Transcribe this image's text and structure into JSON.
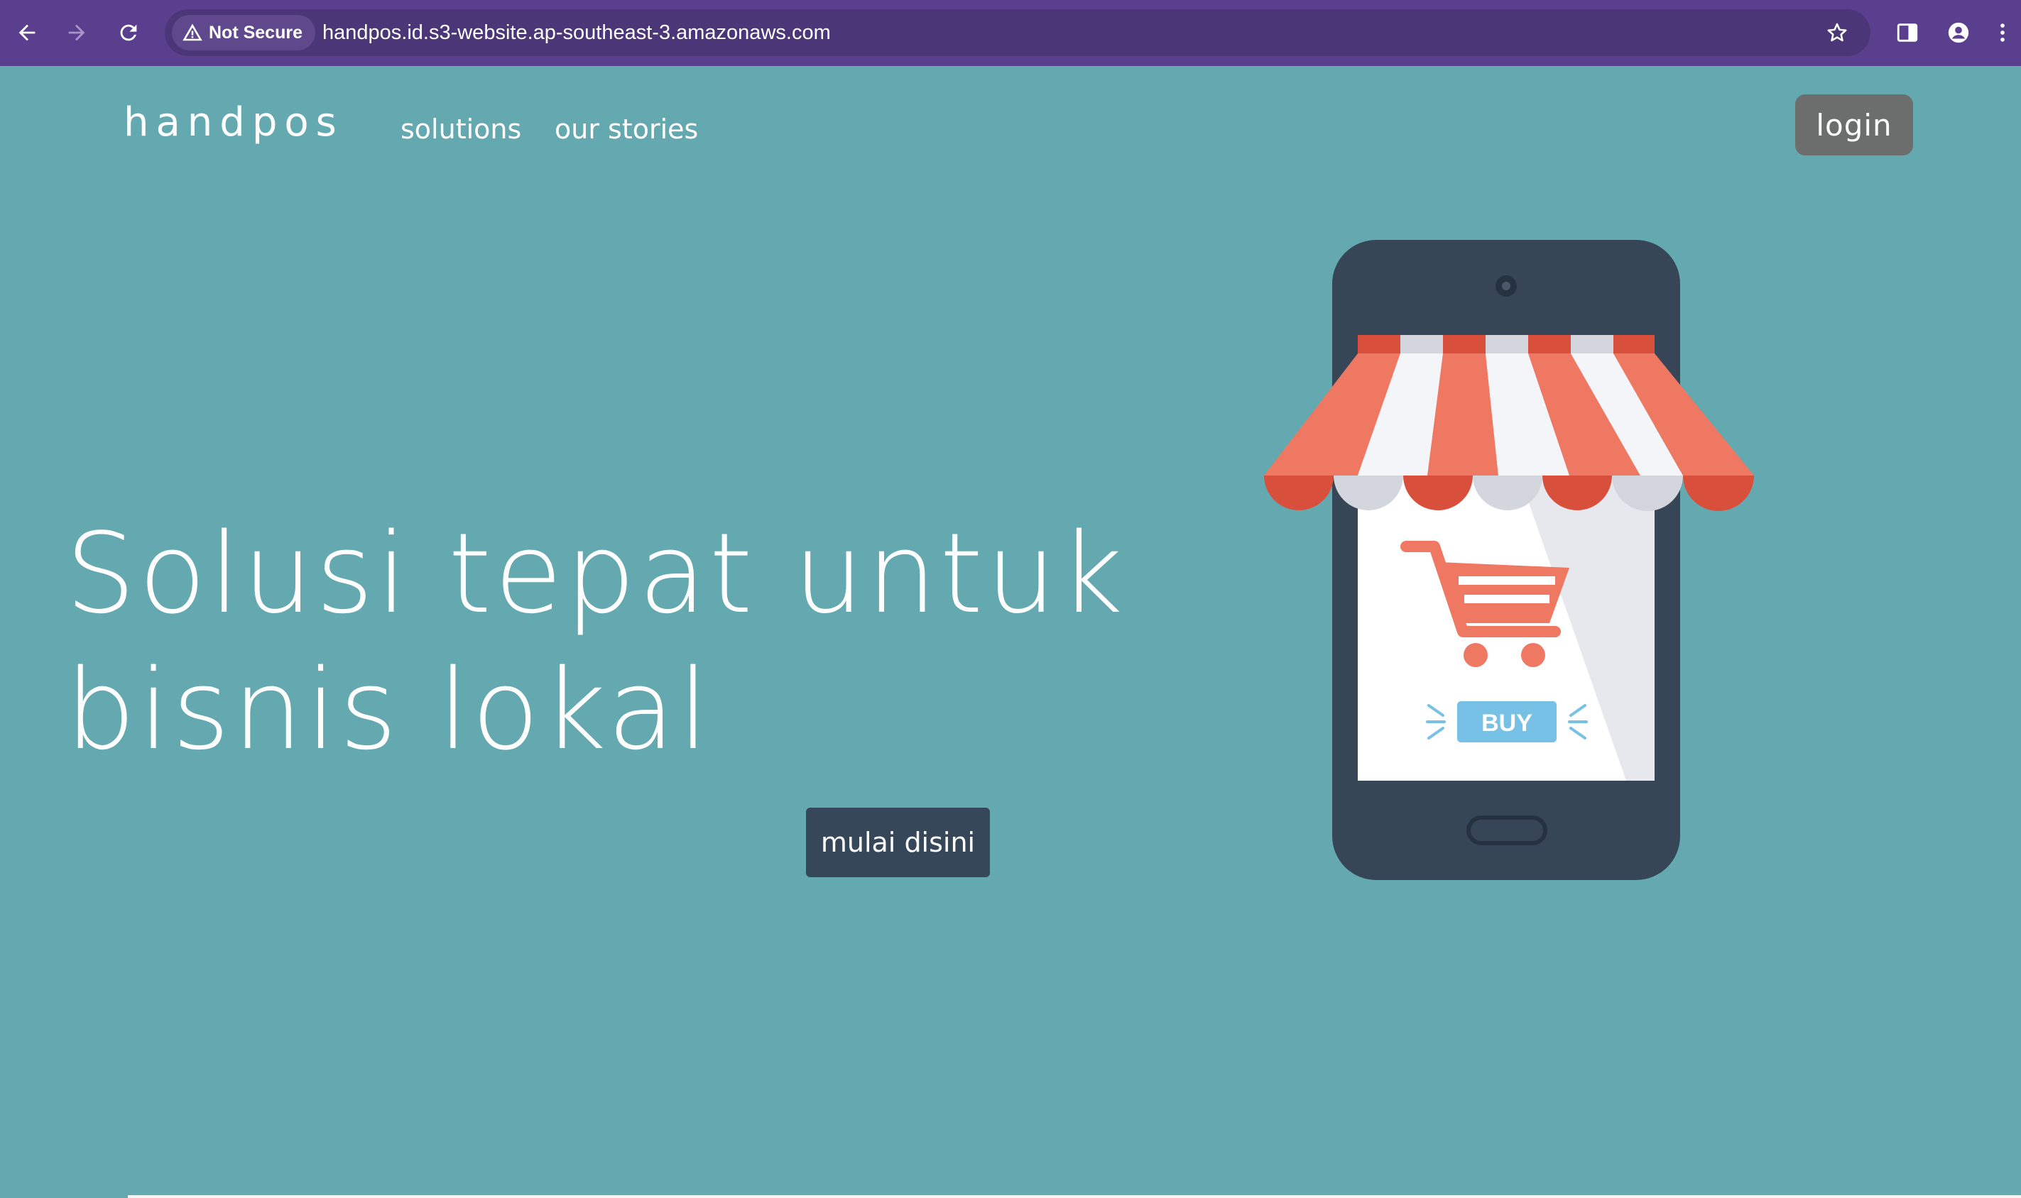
{
  "browser": {
    "security_label": "Not Secure",
    "url": "handpos.id.s3-website.ap-southeast-3.amazonaws.com",
    "icons": [
      "back-icon",
      "forward-icon",
      "reload-icon",
      "warning-icon",
      "star-icon",
      "side-panel-icon",
      "profile-icon",
      "kebab-menu-icon"
    ]
  },
  "header": {
    "brand": "handpos",
    "nav": [
      "solutions",
      "our stories"
    ],
    "login_label": "login"
  },
  "hero": {
    "title_line1": "Solusi tepat untuk",
    "title_line2": "bisnis lokal",
    "cta_label": "mulai disini"
  },
  "illustration": {
    "buy_label": "BUY",
    "icon": "shopping-cart-icon"
  },
  "colors": {
    "background": "#65a9b0",
    "chrome": "#5b3f8f",
    "button_dark": "#364759",
    "login_button": "#6c6e6e",
    "awning_red": "#ef7862",
    "awning_white": "#f4f5f8",
    "buy_blue": "#77c1e6"
  }
}
